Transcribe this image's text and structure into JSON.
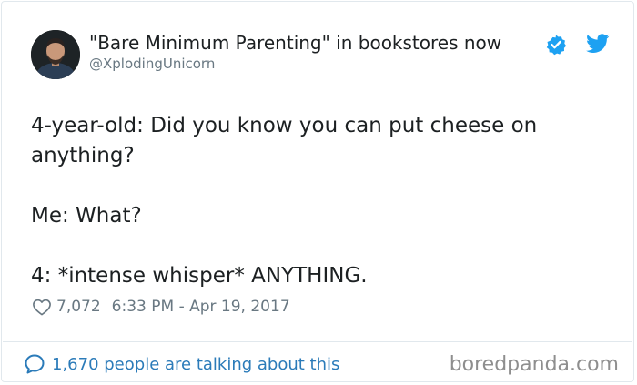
{
  "author": {
    "display_name": "\"Bare Minimum Parenting\" in bookstores now",
    "handle": "@XplodingUnicorn",
    "verified": true
  },
  "tweet": {
    "lines": [
      "4-year-old: Did you know you can put cheese on anything?",
      "Me: What?",
      "4: *intense whisper* ANYTHING."
    ],
    "like_count": "7,072",
    "timestamp": "6:33 PM - Apr 19, 2017"
  },
  "footer": {
    "talking_text": "1,670 people are talking about this"
  },
  "watermark": "boredpanda.com",
  "icons": {
    "verified": "verified-badge-icon",
    "brand": "twitter-bird-icon",
    "like": "heart-icon",
    "reply": "speech-bubble-icon"
  },
  "colors": {
    "link": "#2b7bb9",
    "twitter_blue": "#1da1f2",
    "muted": "#697882",
    "text": "#1c2022"
  }
}
